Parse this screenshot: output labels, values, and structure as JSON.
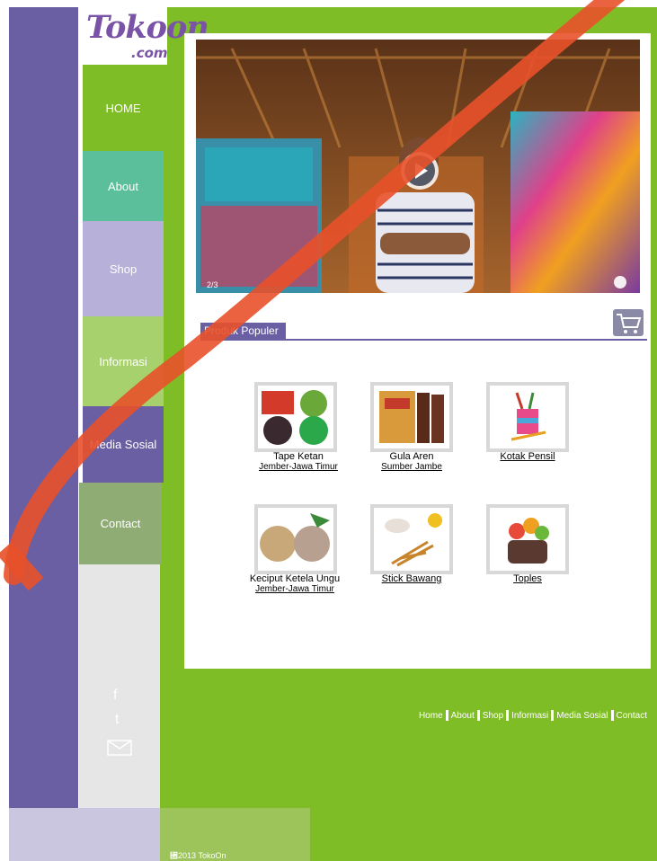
{
  "brand": {
    "logo_text": "Tokoon",
    "logo_suffix": ".com"
  },
  "nav": {
    "items": [
      {
        "label": "HOME",
        "color": "#7fbd26"
      },
      {
        "label": "About",
        "color": "#5bbf9b"
      },
      {
        "label": "Shop",
        "color": "#b7b0d8"
      },
      {
        "label": "Informasi",
        "color": "#a7d16c"
      },
      {
        "label": "Media Sosial",
        "color": "#6b5fa3"
      },
      {
        "label": "Contact",
        "color": "#8fac75"
      }
    ]
  },
  "social": {
    "facebook": "f",
    "twitter": "t",
    "mail_icon": "envelope-icon"
  },
  "hero": {
    "slide_number": "2/3",
    "play_icon": "play-icon"
  },
  "section": {
    "title": "Produk Populer",
    "cart_icon": "shopping-cart-icon"
  },
  "products": [
    {
      "name": "Tape Ketan",
      "origin": "Jember-Jawa Timur",
      "name_underlined": false
    },
    {
      "name": "Gula Aren",
      "origin": "Sumber Jambe",
      "name_underlined": false
    },
    {
      "name": "Kotak Pensil",
      "origin": "",
      "name_underlined": true
    },
    {
      "name": "Keciput Ketela Ungu",
      "origin": "Jember-Jawa Timur",
      "name_underlined": false
    },
    {
      "name": "Stick Bawang",
      "origin": "",
      "name_underlined": true
    },
    {
      "name": "Toples",
      "origin": "",
      "name_underlined": true
    }
  ],
  "footer": {
    "links": [
      "Home",
      "About",
      "Shop",
      "Informasi",
      "Media Sosial",
      "Contact"
    ],
    "copyright": "⑒2013 TokoOn"
  },
  "colors": {
    "purple": "#6b5fa3",
    "green": "#7fbd26",
    "watermark": "#e8512a"
  }
}
